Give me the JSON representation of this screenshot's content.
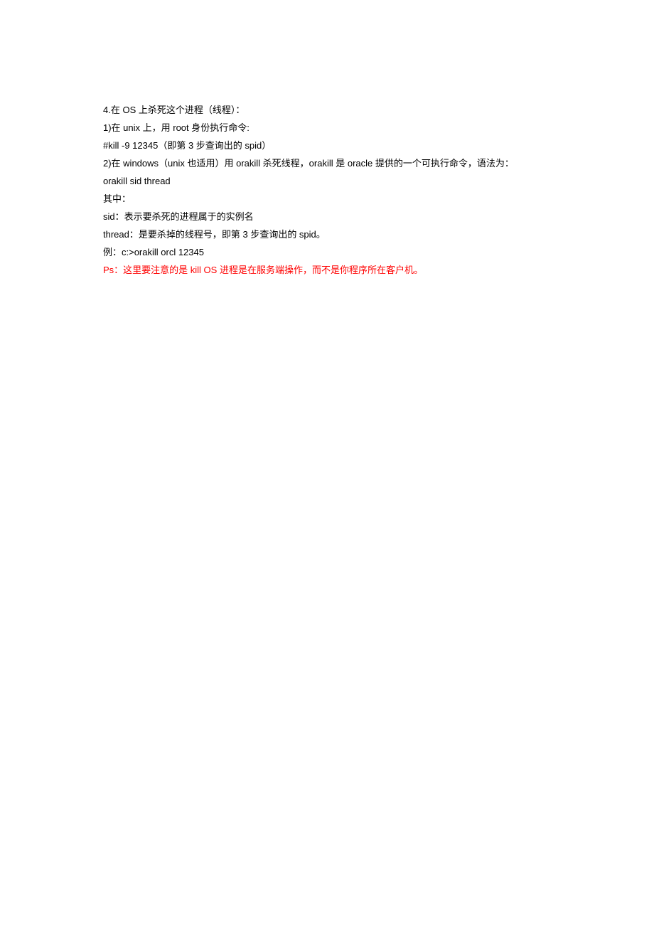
{
  "lines": [
    {
      "text": "4.在 OS 上杀死这个进程（线程）：",
      "cls": ""
    },
    {
      "text": "1)在 unix 上，用 root 身份执行命令:",
      "cls": ""
    },
    {
      "text": "#kill -9 12345（即第 3 步查询出的 spid）",
      "cls": ""
    },
    {
      "text": "2)在 windows（unix 也适用）用 orakill 杀死线程，orakill 是 oracle 提供的一个可执行命令，语法为：",
      "cls": ""
    },
    {
      "text": "orakill sid thread",
      "cls": ""
    },
    {
      "text": "其中：",
      "cls": ""
    },
    {
      "text": "sid：表示要杀死的进程属于的实例名",
      "cls": ""
    },
    {
      "text": "thread：是要杀掉的线程号，即第 3 步查询出的 spid。",
      "cls": ""
    },
    {
      "text": "例：c:>orakill orcl 12345",
      "cls": ""
    },
    {
      "text": "Ps：这里要注意的是 kill OS 进程是在服务端操作，而不是你程序所在客户机。",
      "cls": "red"
    }
  ]
}
